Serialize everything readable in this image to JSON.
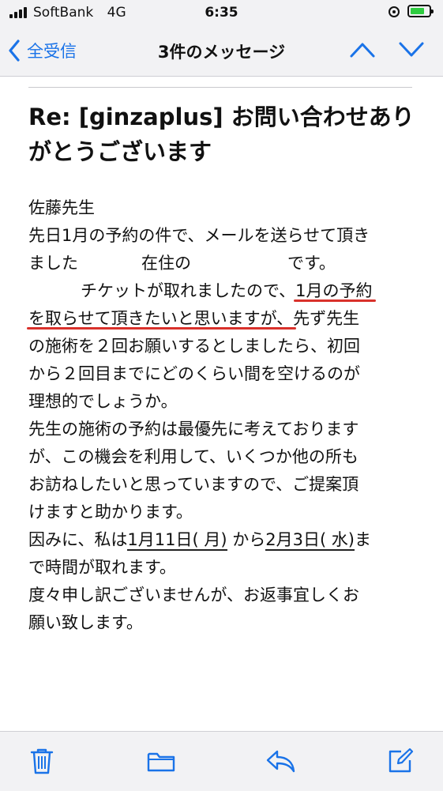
{
  "status_bar": {
    "carrier": "SoftBank",
    "network": "4G",
    "time": "6:35"
  },
  "nav": {
    "back_label": "全受信",
    "title": "3件のメッセージ",
    "accent_color": "#1a73e8"
  },
  "email": {
    "subject_line1": "Re: [ginzaplus] お問い合わせあり",
    "subject_line2": "がとうございます",
    "salutation": "佐藤先生",
    "l2": "先日1月の予約の件で、メールを送らせて頂き",
    "l3a": "ました",
    "l3b": "在住の",
    "l3c": "です。",
    "l4a": "チケットが取れましたので、",
    "l4b": "1月の予約",
    "l5a": "を取らせて頂きたいと思いますが、",
    "l5b": "先ず先生",
    "l6": "の施術を２回お願いするとしましたら、初回",
    "l7": "から２回目までにどのくらい間を空けるのが",
    "l8": "理想的でしょうか。",
    "l9": "先生の施術の予約は最優先に考えております",
    "l10": "が、この機会を利用して、いくつか他の所も",
    "l11": "お訪ねしたいと思っていますので、ご提案頂",
    "l12": "けますと助かります。",
    "l13a": "因みに、私は",
    "l13b": "1月11日( 月)",
    "l13c": " から",
    "l13d": "2月3日( 水)",
    "l13e": "ま",
    "l14": "で時間が取れます。",
    "l15": "度々申し訳ございませんが、お返事宜しくお",
    "l16": "願い致します。",
    "highlight_color": "#d9312b"
  },
  "toolbar": {
    "icons": [
      "trash-icon",
      "folder-icon",
      "reply-icon",
      "compose-icon"
    ]
  }
}
